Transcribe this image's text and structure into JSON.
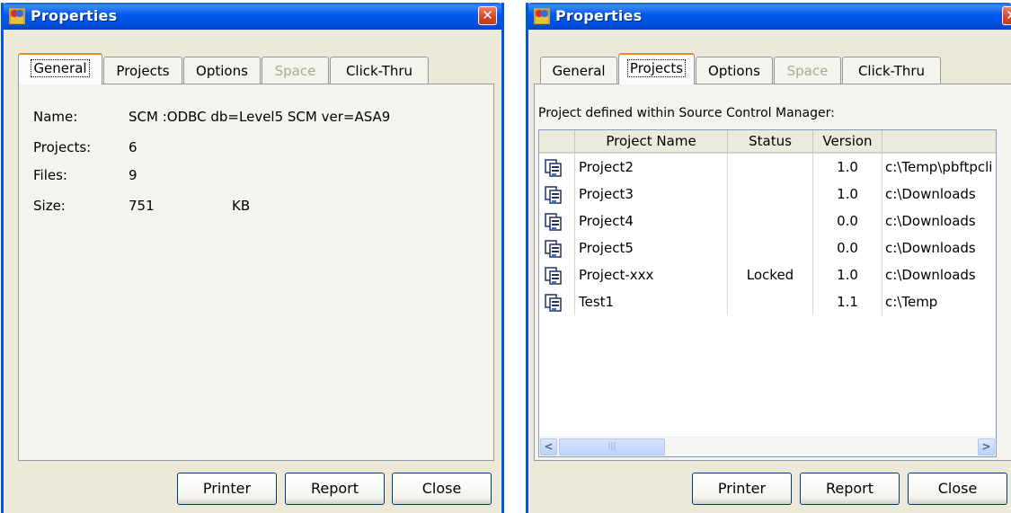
{
  "dialog_left": {
    "title": "Properties",
    "tabs": [
      {
        "label": "General",
        "active": true,
        "enabled": true
      },
      {
        "label": "Projects",
        "active": false,
        "enabled": true
      },
      {
        "label": "Options",
        "active": false,
        "enabled": true
      },
      {
        "label": "Space",
        "active": false,
        "enabled": false
      },
      {
        "label": "Click-Thru",
        "active": false,
        "enabled": true
      }
    ],
    "fields": {
      "name_label": "Name:",
      "name_value": "SCM :ODBC db=Level5 SCM ver=ASA9",
      "projects_label": "Projects:",
      "projects_value": "6",
      "files_label": "Files:",
      "files_value": "9",
      "size_label": "Size:",
      "size_value": "751",
      "size_unit": "KB"
    },
    "buttons": {
      "printer": "Printer",
      "report": "Report",
      "close": "Close"
    }
  },
  "dialog_right": {
    "title": "Properties",
    "tabs": [
      {
        "label": "General",
        "active": false,
        "enabled": true
      },
      {
        "label": "Projects",
        "active": true,
        "enabled": true
      },
      {
        "label": "Options",
        "active": false,
        "enabled": true
      },
      {
        "label": "Space",
        "active": false,
        "enabled": false
      },
      {
        "label": "Click-Thru",
        "active": false,
        "enabled": true
      }
    ],
    "caption": "Project defined within Source Control Manager:",
    "columns": [
      "Project Name",
      "Status",
      "Version",
      ""
    ],
    "rows": [
      {
        "name": "Project2",
        "status": "",
        "version": "1.0",
        "path": "c:\\Temp\\pbftpcli"
      },
      {
        "name": "Project3",
        "status": "",
        "version": "1.0",
        "path": "c:\\Downloads"
      },
      {
        "name": "Project4",
        "status": "",
        "version": "0.0",
        "path": "c:\\Downloads"
      },
      {
        "name": "Project5",
        "status": "",
        "version": "0.0",
        "path": "c:\\Downloads"
      },
      {
        "name": "Project-xxx",
        "status": "Locked",
        "version": "1.0",
        "path": "c:\\Downloads"
      },
      {
        "name": "Test1",
        "status": "",
        "version": "1.1",
        "path": "c:\\Temp"
      }
    ],
    "buttons": {
      "printer": "Printer",
      "report": "Report",
      "close": "Close"
    }
  },
  "colors": {
    "titlebar": "#0054e3",
    "dialog_bg": "#ece9d8",
    "active_tab_accent": "#e68b2c"
  }
}
